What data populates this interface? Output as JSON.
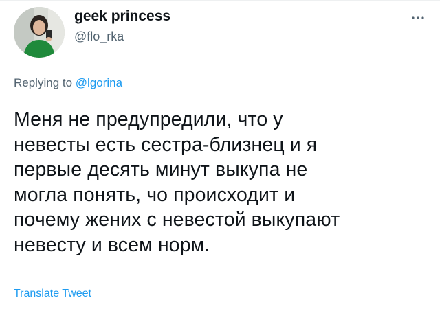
{
  "author": {
    "display_name": "geek princess",
    "handle": "@flo_rka",
    "avatar_icon": "profile-photo"
  },
  "reply": {
    "prefix": "Replying to",
    "target": "@lgorina"
  },
  "tweet": {
    "text_lines": [
      "Меня не предупредили, что у",
      "невесты есть сестра-близнец и я",
      "первые десять минут выкупа не",
      "могла понять, чо происходит и",
      "почему жених с невестой выкупают",
      "невесту и всем норм."
    ]
  },
  "actions": {
    "more_icon": "more-horizontal",
    "translate_label": "Translate Tweet"
  },
  "colors": {
    "text_primary": "#0f1419",
    "text_secondary": "#536471",
    "accent": "#1d9bf0",
    "background": "#ffffff"
  }
}
